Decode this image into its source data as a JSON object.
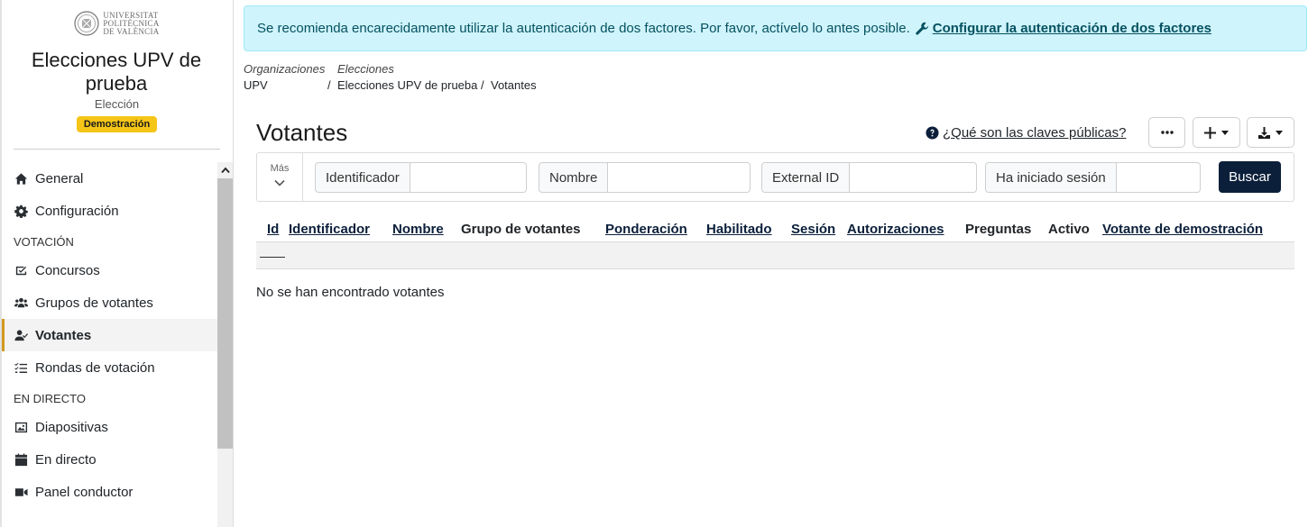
{
  "sidebar": {
    "logo_lines": [
      "UNIVERSITAT",
      "POLITÈCNICA",
      "DE VALÈNCIA"
    ],
    "election_title": "Elecciones UPV de prueba",
    "election_type": "Elección",
    "badge": "Demostración",
    "items_general": [
      {
        "label": "General",
        "icon": "home-icon"
      },
      {
        "label": "Configuración",
        "icon": "gear-icon"
      }
    ],
    "section_votacion": "VOTACIÓN",
    "items_votacion": [
      {
        "label": "Concursos",
        "icon": "ballot-icon"
      },
      {
        "label": "Grupos de votantes",
        "icon": "users-icon"
      },
      {
        "label": "Votantes",
        "icon": "user-check-icon",
        "active": true
      },
      {
        "label": "Rondas de votación",
        "icon": "list-check-icon"
      }
    ],
    "section_directo": "EN DIRECTO",
    "items_directo": [
      {
        "label": "Diapositivas",
        "icon": "image-icon"
      },
      {
        "label": "En directo",
        "icon": "calendar-icon"
      },
      {
        "label": "Panel conductor",
        "icon": "video-icon"
      }
    ]
  },
  "alert": {
    "text": "Se recomienda encarecidamente utilizar la autenticación de dos factores. Por favor, actívelo lo antes posible.",
    "link": "Configurar la autenticación de dos factores",
    "icon": "wrench-icon"
  },
  "breadcrumb": [
    {
      "label": "Organizaciones",
      "value": "UPV"
    },
    {
      "label": "Elecciones",
      "value": "Elecciones UPV de prueba"
    },
    {
      "label": "",
      "value": "Votantes"
    }
  ],
  "page": {
    "title": "Votantes",
    "help_link": "¿Qué son las claves públicas?"
  },
  "filters": {
    "more_label": "Más",
    "fields": [
      "Identificador",
      "Nombre",
      "External ID",
      "Ha iniciado sesión"
    ],
    "search_button": "Buscar"
  },
  "table": {
    "columns": [
      {
        "label": "Id",
        "link": true
      },
      {
        "label": "Identificador",
        "link": true
      },
      {
        "label": "Nombre",
        "link": true
      },
      {
        "label": "Grupo de votantes",
        "link": false
      },
      {
        "label": "Ponderación",
        "link": true
      },
      {
        "label": "Habilitado",
        "link": true
      },
      {
        "label": "Sesión",
        "link": true
      },
      {
        "label": "Autorizaciones",
        "link": true
      },
      {
        "label": "Preguntas",
        "link": false
      },
      {
        "label": "Activo",
        "link": false
      },
      {
        "label": "Votante de demostración",
        "link": true
      }
    ],
    "placeholder_row": "——",
    "empty_message": "No se han encontrado votantes"
  },
  "colors": {
    "alert_bg": "#cff4fc",
    "primary_button": "#0b1f3a",
    "badge": "#f5c518",
    "active_indicator": "#d19a1f"
  }
}
